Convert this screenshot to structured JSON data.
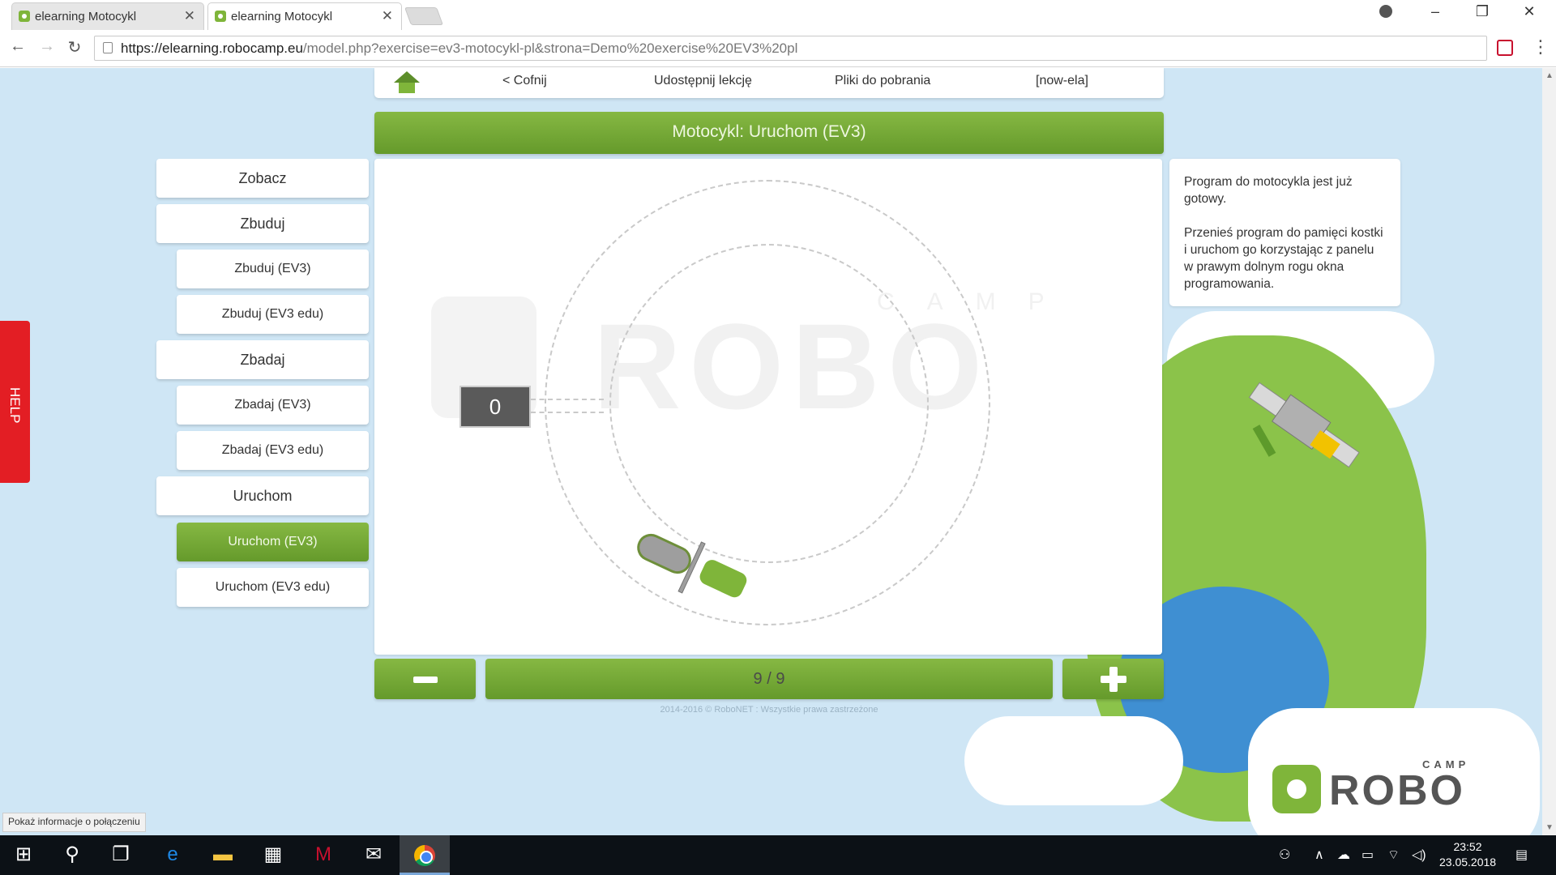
{
  "browser": {
    "tabs": [
      {
        "title": "elearning Motocykl",
        "active": false
      },
      {
        "title": "elearning Motocykl",
        "active": true
      }
    ],
    "url_host": "https://elearning.robocamp.eu",
    "url_path": "/model.php?exercise=ev3-motocykl-pl&strona=Demo%20exercise%20EV3%20pl",
    "status_hint": "Pokaż informacje o połączeniu"
  },
  "topnav": {
    "back": "< Cofnij",
    "share": "Udostępnij lekcję",
    "downloads": "Pliki do pobrania",
    "user": "[now-ela]"
  },
  "title": "Motocykl: Uruchom (EV3)",
  "sidebar": {
    "items": [
      {
        "label": "Zobacz",
        "level": "main",
        "active": false
      },
      {
        "label": "Zbuduj",
        "level": "main",
        "active": false
      },
      {
        "label": "Zbuduj (EV3)",
        "level": "sub",
        "active": false
      },
      {
        "label": "Zbuduj (EV3 edu)",
        "level": "sub",
        "active": false
      },
      {
        "label": "Zbadaj",
        "level": "main",
        "active": false
      },
      {
        "label": "Zbadaj (EV3)",
        "level": "sub",
        "active": false
      },
      {
        "label": "Zbadaj (EV3 edu)",
        "level": "sub",
        "active": false
      },
      {
        "label": "Uruchom",
        "level": "main",
        "active": false
      },
      {
        "label": "Uruchom (EV3)",
        "level": "sub",
        "active": true
      },
      {
        "label": "Uruchom (EV3 edu)",
        "level": "sub",
        "active": false
      }
    ]
  },
  "help_label": "HELP",
  "simulation": {
    "counter": "0",
    "watermark": "ROBO",
    "watermark_camp": "CAMP"
  },
  "pager": {
    "text": "9 / 9"
  },
  "copyright": "2014-2016 © RoboNET : Wszystkie prawa zastrzeżone",
  "info": {
    "p1": "Program do motocykla jest już gotowy.",
    "p2": "Przenieś program do pamięci kostki i uruchom go korzystając z panelu w prawym dolnym rogu okna programowania."
  },
  "logo": {
    "robo": "ROBO",
    "camp": "CAMP"
  },
  "taskbar": {
    "time": "23:52",
    "date": "23.05.2018"
  },
  "colors": {
    "accent_green": "#7fb53a",
    "help_red": "#e31e24",
    "page_bg": "#cfe6f5"
  }
}
